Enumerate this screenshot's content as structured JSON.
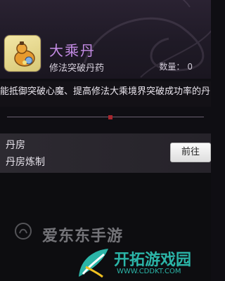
{
  "item": {
    "name": "大乘丹",
    "subtitle": "修法突破丹药",
    "quantity_label": "数量：",
    "quantity_value": "0",
    "description": "能抵御突破心魔、提高修法大乘境界突破成功率的丹"
  },
  "source": {
    "name": "丹房",
    "desc": "丹房炼制",
    "button_label": "前往"
  },
  "watermarks": {
    "line1": "爱东东手游",
    "line2": "开拓游戏园",
    "line3": "WWW.CDDKT.COM"
  },
  "colors": {
    "item_name": "#c58ce6",
    "accent_red": "#a8262e",
    "watermark_teal": "#2bb5a8"
  },
  "icons": {
    "item": "gourd-pill-icon",
    "logo": "leaf-logo-icon"
  }
}
